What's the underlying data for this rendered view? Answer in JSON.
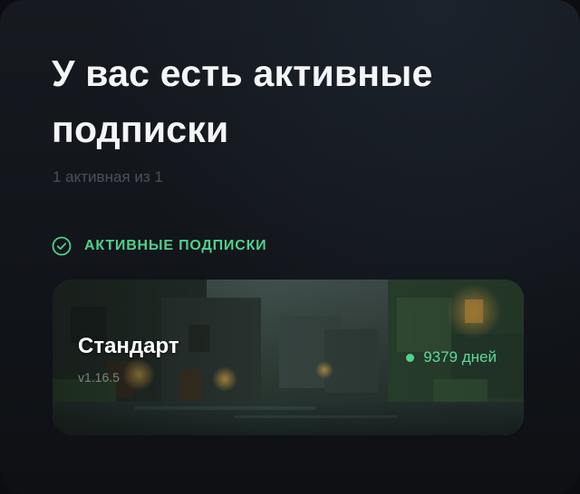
{
  "header": {
    "title": "У вас есть активные подписки",
    "subtitle": "1 активная из 1"
  },
  "section": {
    "label": "АКТИВНЫЕ ПОДПИСКИ",
    "icon": "check-circle-icon"
  },
  "subscriptions": [
    {
      "name": "Стандарт",
      "version": "v1.16.5",
      "days_left": "9379 дней",
      "status": "active"
    }
  ],
  "colors": {
    "accent": "#4fd08b",
    "background": "#111419",
    "title": "#f4f5f7"
  }
}
